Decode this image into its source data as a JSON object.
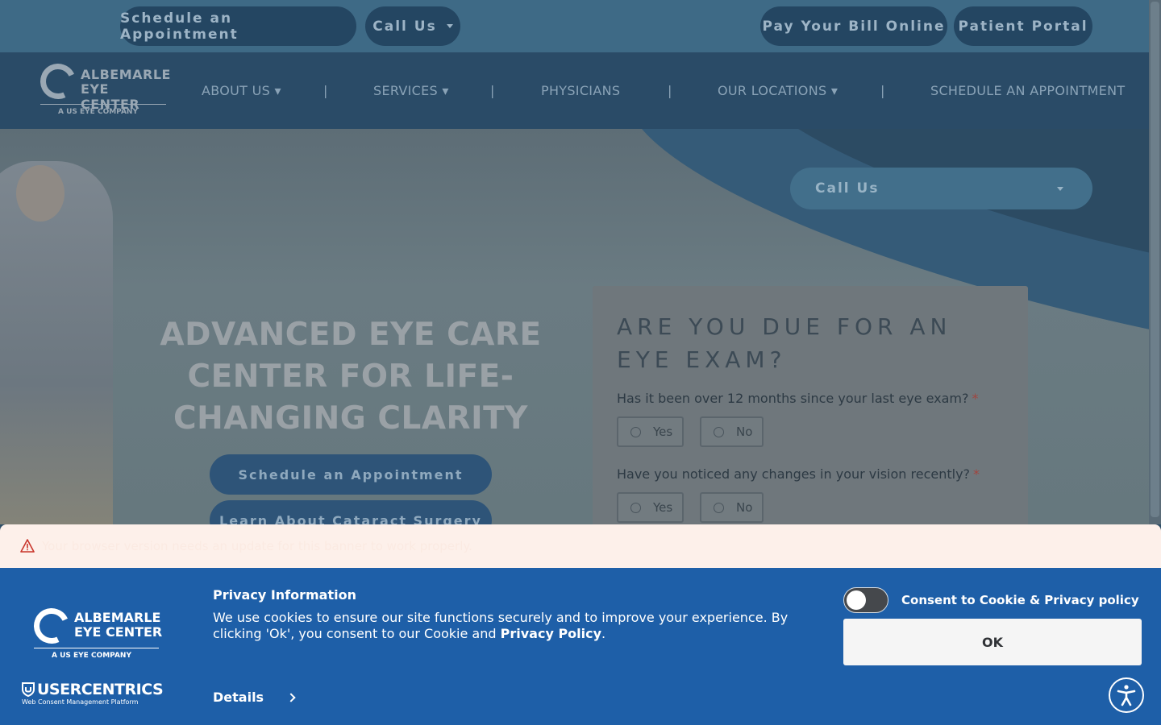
{
  "topbar": {
    "schedule_label": "Schedule an Appointment",
    "callus_label": "Call Us",
    "paybill_label": "Pay Your Bill Online",
    "portal_label": "Patient Portal"
  },
  "logo": {
    "line1": "ALBEMARLE",
    "line2": "EYE CENTER",
    "line3": "A US EYE COMPANY"
  },
  "nav": {
    "items": [
      {
        "label": "ABOUT US ▾"
      },
      {
        "label": "SERVICES ▾"
      },
      {
        "label": "PHYSICIANS"
      },
      {
        "label": "OUR LOCATIONS ▾"
      },
      {
        "label": "SCHEDULE AN APPOINTMENT"
      }
    ],
    "separator": "|"
  },
  "hero": {
    "callus_dropdown": "Call Us",
    "headline": "ADVANCED EYE CARE CENTER FOR LIFE-CHANGING CLARITY",
    "btn_schedule": "Schedule an Appointment",
    "btn_cataract": "Learn About Cataract Surgery"
  },
  "form": {
    "title": "ARE YOU DUE FOR AN EYE EXAM?",
    "required_mark": "*",
    "questions": [
      {
        "text": "Has it been over 12 months since your last eye exam?",
        "options": [
          "Yes",
          "No"
        ]
      },
      {
        "text": "Have you noticed any changes in your vision recently?",
        "options": [
          "Yes",
          "No"
        ]
      }
    ]
  },
  "warning": {
    "text": "Your browser version needs an update for this banner to work properly."
  },
  "consent": {
    "title": "Privacy Information",
    "body_prefix": "We use cookies to ensure our site functions securely and to improve your experience. By clicking 'Ok', you consent to our Cookie and ",
    "body_link": "Privacy Policy",
    "body_suffix": ".",
    "details_label": "Details",
    "toggle_label": "Consent to Cookie & Privacy policy",
    "toggle_on": false,
    "ok_label": "OK",
    "brand_name": "USERCENTRICS",
    "brand_sub": "Web Consent Management Platform"
  },
  "colors": {
    "consent_bg": "#1e5fa8",
    "warning_bg": "#fdf0ea",
    "nav_bg": "#2a4b67"
  },
  "icons": {
    "warning": "warning-triangle-icon",
    "accessibility": "accessibility-icon",
    "chevron": "chevron-right-icon"
  }
}
